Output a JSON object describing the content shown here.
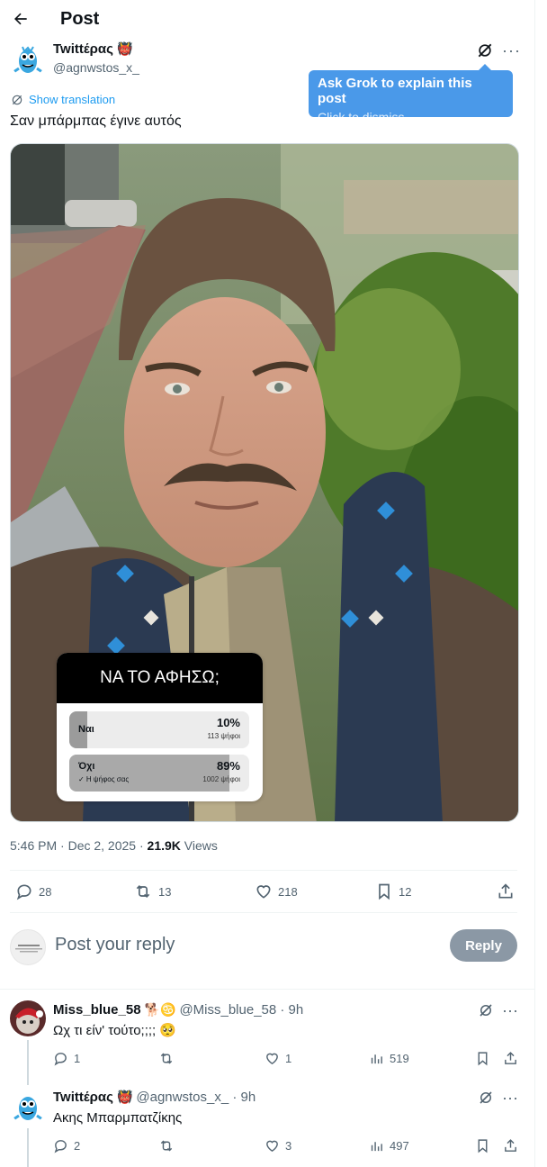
{
  "header": {
    "title": "Post"
  },
  "post": {
    "author_name": "Twittέρας",
    "author_emoji": "👹",
    "author_handle": "@agnwstos_x_",
    "show_translation": "Show translation",
    "text": "Σαν μπάρμπας έγινε αυτός",
    "time": "5:46 PM · Dec 2, 2025 · ",
    "views_count": "21.9K",
    "views_label": " Views",
    "stats": {
      "replies": "28",
      "reposts": "13",
      "likes": "218",
      "bookmarks": "12"
    }
  },
  "tooltip": {
    "title": "Ask Grok to explain this post",
    "subtitle": "Click to dismiss"
  },
  "poll": {
    "question": "ΝΑ ΤΟ ΑΦΗΣΩ;",
    "options": [
      {
        "label": "Ναι",
        "percent": "10%",
        "votes": "113 ψήφοι",
        "note": "",
        "fill": 0.1
      },
      {
        "label": "Όχι",
        "percent": "89%",
        "votes": "1002 ψήφοι",
        "note": "✓ Η ψήφος σας",
        "fill": 0.89
      }
    ]
  },
  "composer": {
    "placeholder": "Post your reply",
    "button": "Reply"
  },
  "replies": [
    {
      "name": "Miss_blue_58",
      "emojis": "🐕♋",
      "handle": "@Miss_blue_58 · 9h",
      "text": "Ωχ τι είν' τούτο;;;; 🥺",
      "replies": "1",
      "reposts": "",
      "likes": "1",
      "views": "519"
    },
    {
      "name": "Twittέρας",
      "emojis": "👹",
      "handle": "@agnwstos_x_ · 9h",
      "text": "Ακης Μπαρμπατζίκης",
      "replies": "2",
      "reposts": "",
      "likes": "3",
      "views": "497"
    }
  ],
  "colors": {
    "accent": "#1d9bf0",
    "tooltip": "#4a99e9"
  }
}
